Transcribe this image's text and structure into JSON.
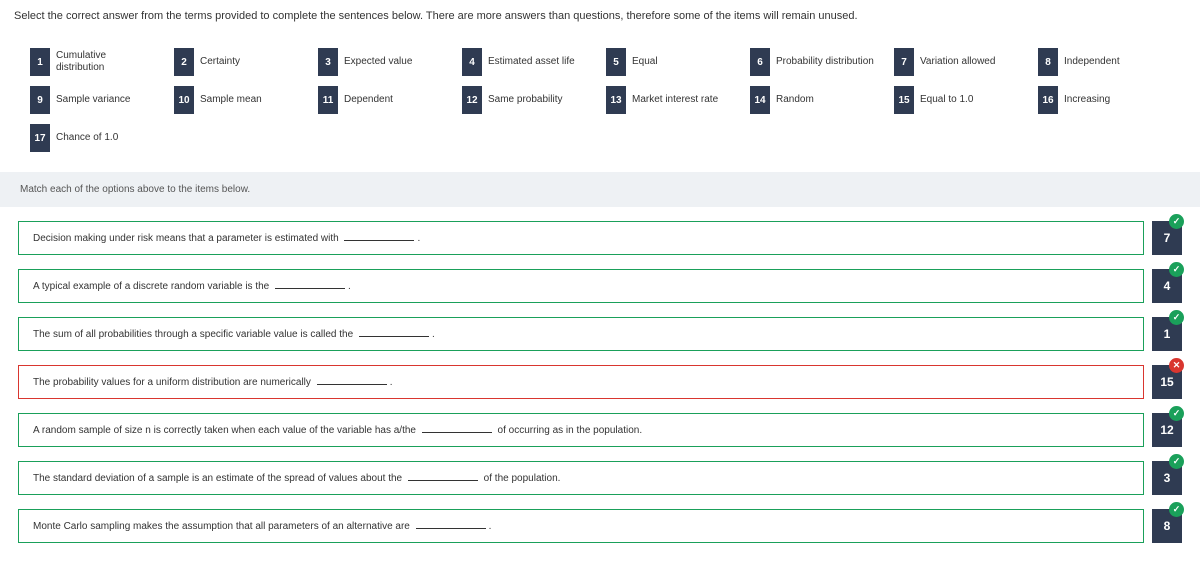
{
  "instructions": "Select the correct answer from the terms provided to complete the sentences below. There are more answers than questions, therefore some of the items will remain unused.",
  "terms": [
    {
      "n": "1",
      "label": "Cumulative distribution"
    },
    {
      "n": "2",
      "label": "Certainty"
    },
    {
      "n": "3",
      "label": "Expected value"
    },
    {
      "n": "4",
      "label": "Estimated asset life"
    },
    {
      "n": "5",
      "label": "Equal"
    },
    {
      "n": "6",
      "label": "Probability distribution"
    },
    {
      "n": "7",
      "label": "Variation allowed"
    },
    {
      "n": "8",
      "label": "Independent"
    },
    {
      "n": "9",
      "label": "Sample variance"
    },
    {
      "n": "10",
      "label": "Sample mean"
    },
    {
      "n": "11",
      "label": "Dependent"
    },
    {
      "n": "12",
      "label": "Same probability"
    },
    {
      "n": "13",
      "label": "Market interest rate"
    },
    {
      "n": "14",
      "label": "Random"
    },
    {
      "n": "15",
      "label": "Equal to 1.0"
    },
    {
      "n": "16",
      "label": "Increasing"
    },
    {
      "n": "17",
      "label": "Chance of 1.0"
    }
  ],
  "match_label": "Match each of the options above to the items below.",
  "answers": [
    {
      "pre": "Decision making under risk means that a parameter is estimated with ",
      "mid": "",
      "post": ".",
      "selected": "7",
      "correct": true
    },
    {
      "pre": "A typical example of a discrete random variable is the ",
      "mid": "",
      "post": ".",
      "selected": "4",
      "correct": true
    },
    {
      "pre": "The sum of all probabilities through a specific variable value is called the ",
      "mid": "",
      "post": ".",
      "selected": "1",
      "correct": true
    },
    {
      "pre": "The probability values for a uniform distribution are numerically ",
      "mid": "",
      "post": ".",
      "selected": "15",
      "correct": false
    },
    {
      "pre": "A random sample of size n is correctly taken when each value of the variable has a/the ",
      "mid": " of occurring as in the population.",
      "post": "",
      "selected": "12",
      "correct": true
    },
    {
      "pre": "The standard deviation of a sample is an estimate of the spread of values about the ",
      "mid": " of the population.",
      "post": "",
      "selected": "3",
      "correct": true
    },
    {
      "pre": "Monte Carlo sampling makes the assumption that all parameters of an alternative are ",
      "mid": "",
      "post": ".",
      "selected": "8",
      "correct": true
    }
  ]
}
